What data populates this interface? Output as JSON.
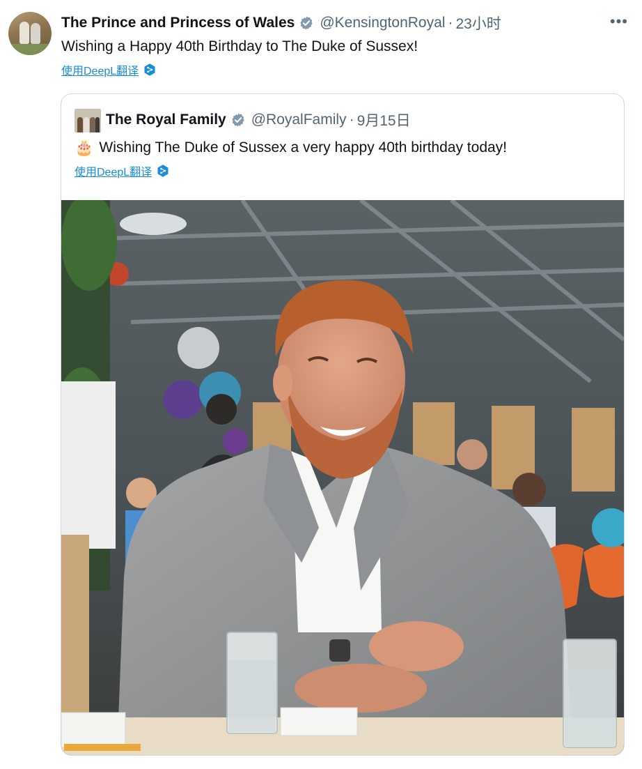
{
  "tweet": {
    "author_name": "The Prince and Princess of Wales",
    "handle": "@KensingtonRoyal",
    "separator": "·",
    "time": "23小时",
    "more": "•••",
    "text": "Wishing a Happy 40th Birthday to The Duke of Sussex!",
    "translate_label": "使用DeepL翻译"
  },
  "quote": {
    "author_name": "The Royal Family",
    "handle": "@RoyalFamily",
    "separator": "·",
    "date": "9月15日",
    "emoji": "🎂",
    "text": "Wishing The Duke of Sussex a very happy 40th birthday today!",
    "translate_label": "使用DeepL翻译"
  },
  "colors": {
    "verified": "#829aab",
    "link": "#1a8cd8",
    "secondary_text": "#536471",
    "deepl": "#0f2b46"
  },
  "icons": {
    "verified": "verified-badge-icon",
    "translate": "deepl-icon",
    "more": "more-icon"
  }
}
